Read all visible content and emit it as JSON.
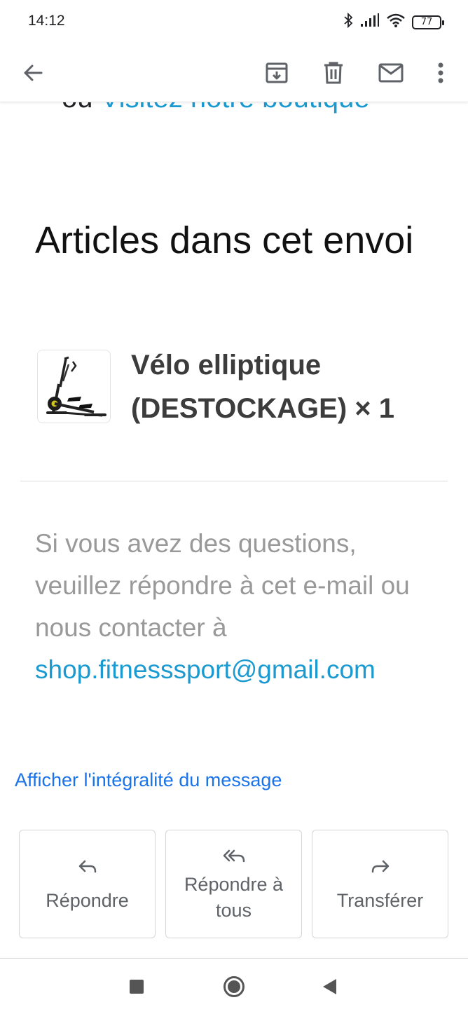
{
  "status_bar": {
    "time": "14:12",
    "battery": "77",
    "icons": [
      "bluetooth-icon",
      "signal-icon",
      "wifi-icon",
      "battery-icon"
    ]
  },
  "toolbar": {
    "icons": [
      "back-arrow-icon",
      "archive-icon",
      "delete-icon",
      "mark-unread-icon",
      "more-vert-icon"
    ]
  },
  "email_body": {
    "cut_prefix": "ou",
    "cut_link": "Visitez notre boutique",
    "section_title": "Articles dans cet envoi",
    "item": {
      "title": "Vélo elliptique (DESTOCKAGE) × 1",
      "image_icon": "elliptical-bike-image"
    },
    "questions_text": "Si vous avez des questions, veuillez répondre à cet e-mail ou nous contacter à",
    "contact_email": "shop.fitnesssport@gmail.com"
  },
  "show_full_message": "Afficher l'intégralité du message",
  "actions": [
    {
      "label": "Répondre",
      "icon": "reply-icon"
    },
    {
      "label": "Répondre à tous",
      "icon": "reply-all-icon"
    },
    {
      "label": "Transférer",
      "icon": "forward-icon"
    }
  ],
  "nav_bar": {
    "icons": [
      "recents-square-icon",
      "home-circle-icon",
      "back-triangle-icon"
    ]
  },
  "colors": {
    "link": "#1a9ad0",
    "show_full_link": "#1a73e8",
    "muted_text": "#999999",
    "accent_yellow": "#d4c51c"
  }
}
